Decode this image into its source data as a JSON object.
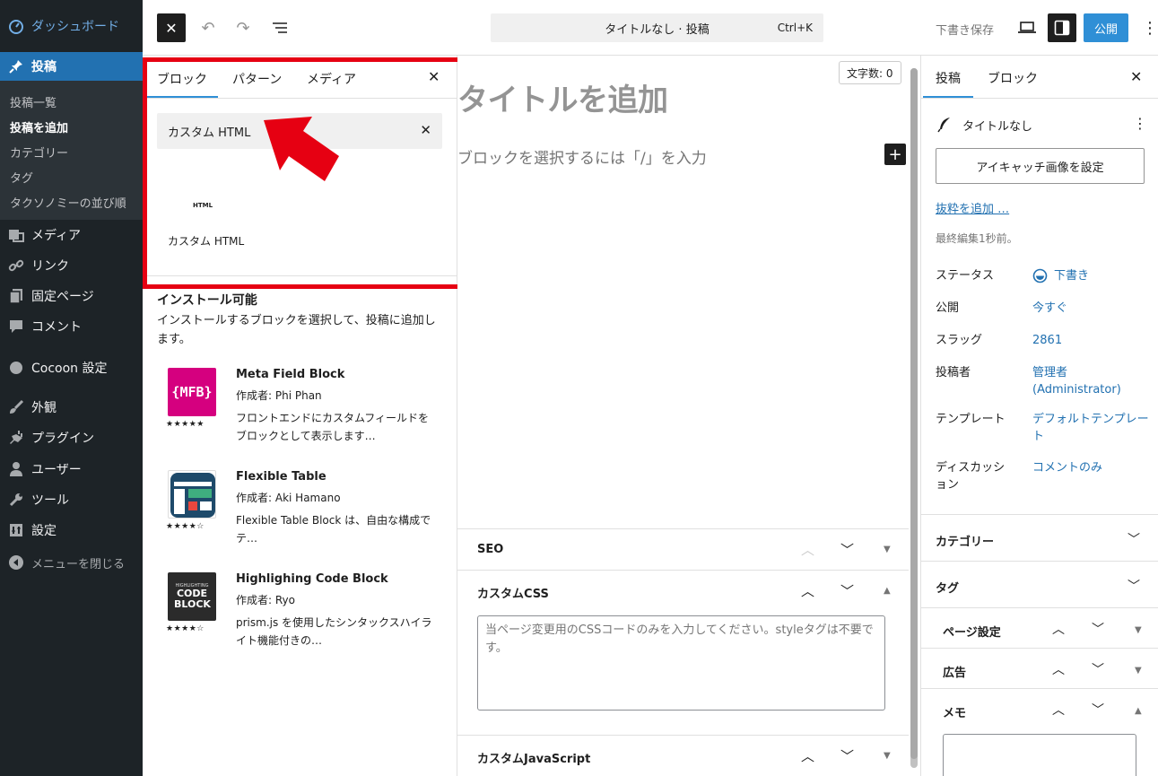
{
  "admin_menu": {
    "dashboard": "ダッシュボード",
    "posts": "投稿",
    "posts_sub": [
      "投稿一覧",
      "投稿を追加",
      "カテゴリー",
      "タグ",
      "タクソノミーの並び順"
    ],
    "media": "メディア",
    "links": "リンク",
    "pages": "固定ページ",
    "comments": "コメント",
    "cocoon": "Cocoon 設定",
    "appearance": "外観",
    "plugins": "プラグイン",
    "users": "ユーザー",
    "tools": "ツール",
    "settings": "設定",
    "collapse": "メニューを閉じる"
  },
  "toolbar": {
    "command_title": "タイトルなし · 投稿",
    "shortcut": "Ctrl+K",
    "save_draft": "下書き保存",
    "publish": "公開"
  },
  "inserter": {
    "tabs": [
      "ブロック",
      "パターン",
      "メディア"
    ],
    "search_value": "カスタム HTML",
    "result_icon_text": "HTML",
    "result_label": "カスタム HTML",
    "install_title": "インストール可能",
    "install_desc": "インストールするブロックを選択して、投稿に追加します。",
    "plugins": [
      {
        "name": "Meta Field Block",
        "author": "作成者: Phi Phan",
        "desc": "フロントエンドにカスタムフィールドをブロックとして表示します…",
        "stars": "★★★★★",
        "rating": 5,
        "logo_text": "{MFB}"
      },
      {
        "name": "Flexible Table",
        "author": "作成者: Aki Hamano",
        "desc": "Flexible Table Block は、自由な構成でテ…",
        "stars": "★★★★☆",
        "rating": 4.5
      },
      {
        "name": "Highlighing Code Block",
        "author": "作成者: Ryo",
        "desc": "prism.js を使用したシンタックスハイライト機能付きの…",
        "stars": "★★★★☆",
        "rating": 4.5,
        "logo_top": "HIGHLIGHTING",
        "logo_text": "CODE BLOCK"
      }
    ]
  },
  "canvas": {
    "word_count": "文字数: 0",
    "title_placeholder": "タイトルを追加",
    "block_placeholder": "ブロックを選択するには「/」を入力"
  },
  "metaboxes": {
    "seo": "SEO",
    "custom_css": "カスタムCSS",
    "css_placeholder": "当ページ変更用のCSSコードのみを入力してください。styleタグは不要です。",
    "custom_js": "カスタムJavaScript"
  },
  "settings_panel": {
    "tabs": [
      "投稿",
      "ブロック"
    ],
    "post_title": "タイトルなし",
    "featured_image": "アイキャッチ画像を設定",
    "excerpt": "抜粋を追加 …",
    "last_edited": "最終編集1秒前。",
    "rows": [
      {
        "label": "ステータス",
        "value": "下書き"
      },
      {
        "label": "公開",
        "value": "今すぐ"
      },
      {
        "label": "スラッグ",
        "value": "2861"
      },
      {
        "label": "投稿者",
        "value": "管理者 (Administrator)"
      },
      {
        "label": "テンプレート",
        "value": "デフォルトテンプレート"
      },
      {
        "label": "ディスカッション",
        "value": "コメントのみ"
      }
    ],
    "sections": [
      "カテゴリー",
      "タグ",
      "ページ設定",
      "広告",
      "メモ"
    ]
  },
  "colors": {
    "admin_bg": "#1d2327",
    "accent": "#2271b1",
    "highlight": "#e60012"
  }
}
